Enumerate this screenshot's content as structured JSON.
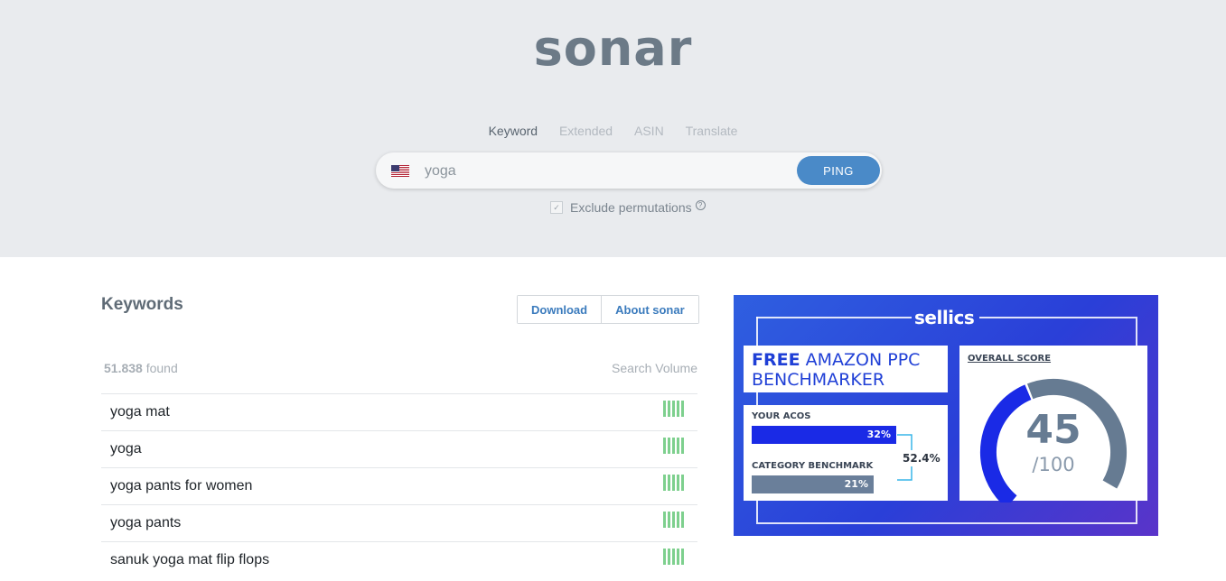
{
  "app": {
    "logo": "sonar"
  },
  "search_tabs": [
    "Keyword",
    "Extended",
    "ASIN",
    "Translate"
  ],
  "search": {
    "value": "yoga",
    "button_label": "PING",
    "flag_icon": "us-flag-icon"
  },
  "options": {
    "exclude_permutations_label": "Exclude permutations",
    "exclude_permutations_checked": true,
    "help_glyph": "?"
  },
  "keywords": {
    "title": "Keywords",
    "download_label": "Download",
    "about_label": "About sonar",
    "found_count": "51.838",
    "found_suffix": "found",
    "volume_header": "Search Volume",
    "rows": [
      {
        "keyword": "yoga mat",
        "volume_bars": 5
      },
      {
        "keyword": "yoga",
        "volume_bars": 5
      },
      {
        "keyword": "yoga pants for women",
        "volume_bars": 5
      },
      {
        "keyword": "yoga pants",
        "volume_bars": 5
      },
      {
        "keyword": "sanuk yoga mat flip flops",
        "volume_bars": 5
      }
    ]
  },
  "ad": {
    "brand": "sellics",
    "headline_bold": "FREE",
    "headline_rest": "AMAZON PPC",
    "headline_line2": "BENCHMARKER",
    "acos_label": "YOUR ACOS",
    "acos_value": "32%",
    "benchmark_label": "CATEGORY BENCHMARK",
    "benchmark_value": "21%",
    "diff_value": "52.4%",
    "score_label": "OVERALL SCORE",
    "score": "45",
    "score_max": "/100",
    "score_fraction": 0.45,
    "colors": {
      "primary": "#1a2ae6",
      "secondary": "#6a7f9a"
    }
  },
  "colors": {
    "accent": "#4a8ac8",
    "volume_bar": "#7ed08e"
  }
}
